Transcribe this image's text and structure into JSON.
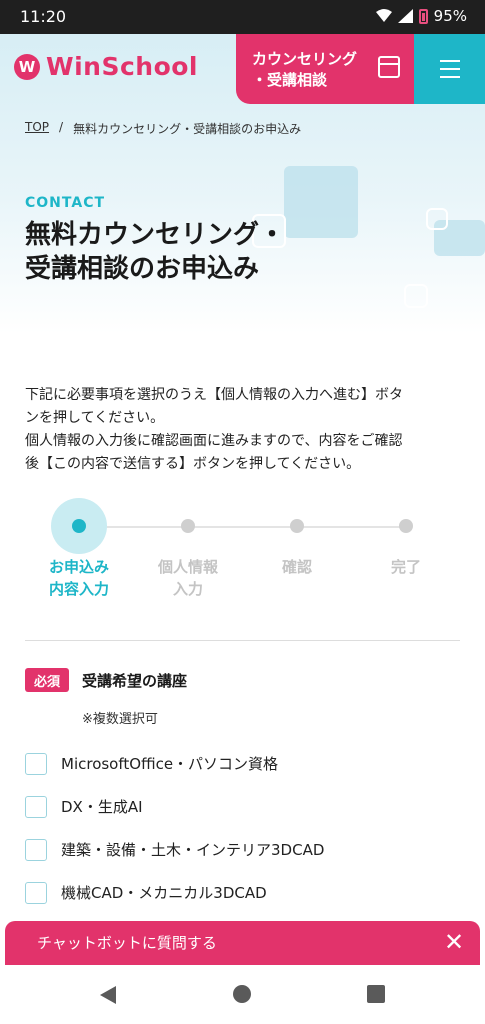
{
  "status_bar": {
    "time": "11:20",
    "battery": "95%"
  },
  "header": {
    "logo_mark": "W",
    "logo_text": "WinSchool",
    "counsel_line1": "カウンセリング",
    "counsel_line2": "・受講相談"
  },
  "breadcrumb": {
    "home": "TOP",
    "separator": "/",
    "current": "無料カウンセリング・受講相談のお申込み"
  },
  "eyebrow": "CONTACT",
  "title": {
    "line1": "無料カウンセリング・",
    "line2": "受講相談のお申込み"
  },
  "intro": {
    "line1": "下記に必要事項を選択のうえ【個人情報の入力へ進む】ボタ",
    "line2": "ンを押してください。",
    "line3": "個人情報の入力後に確認画面に進みますので、内容をご確認",
    "line4": "後【この内容で送信する】ボタンを押してください。"
  },
  "steps": [
    {
      "line1": "お申込み",
      "line2": "内容入力"
    },
    {
      "line1": "個人情報",
      "line2": "入力"
    },
    {
      "line1": "確認",
      "line2": ""
    },
    {
      "line1": "完了",
      "line2": ""
    }
  ],
  "form": {
    "required_badge": "必須",
    "field_title": "受講希望の講座",
    "field_note": "※複数選択可",
    "options": [
      "MicrosoftOffice・パソコン資格",
      "DX・生成AI",
      "建築・設備・土木・インテリア3DCAD",
      "機械CAD・メカニカル3DCAD"
    ]
  },
  "chat_banner": {
    "text": "チャットボットに質問する",
    "close": "✕"
  },
  "colors": {
    "brand_pink": "#e2336b",
    "accent_teal": "#1eb6c8"
  }
}
